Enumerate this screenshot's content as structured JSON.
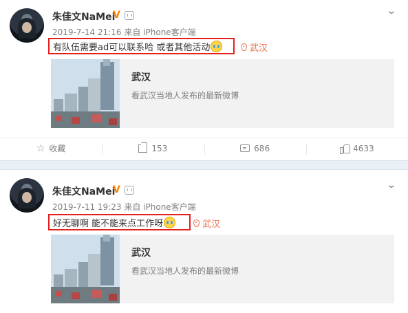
{
  "posts": [
    {
      "author": "朱佳文NaMei",
      "meta_time": "2019-7-14 21:16",
      "meta_from": "来自",
      "meta_source": "iPhone客户端",
      "text": "有队伍需要ad可以联系哈 或者其他活动",
      "location": "武汉",
      "card": {
        "title": "武汉",
        "subtitle": "看武汉当地人发布的最新微博"
      },
      "actions": {
        "favorite": "收藏",
        "forward": "153",
        "comment": "686",
        "like": "4633"
      }
    },
    {
      "author": "朱佳文NaMei",
      "meta_time": "2019-7-11 19:23",
      "meta_from": "来自",
      "meta_source": "iPhone客户端",
      "text": "好无聊啊 能不能来点工作呀",
      "location": "武汉",
      "card": {
        "title": "武汉",
        "subtitle": "看武汉当地人发布的最新微博"
      }
    }
  ],
  "icons": {
    "verified": "V",
    "dropdown": "chevron-down-icon",
    "location": "location-pin-icon",
    "favorite": "star-icon",
    "forward": "forward-icon",
    "comment": "comment-icon",
    "like": "thumbs-up-icon"
  },
  "colors": {
    "highlight_border": "#e3201b",
    "location": "#eb7350",
    "verified": "#ff8200",
    "muted_text": "#808080"
  }
}
